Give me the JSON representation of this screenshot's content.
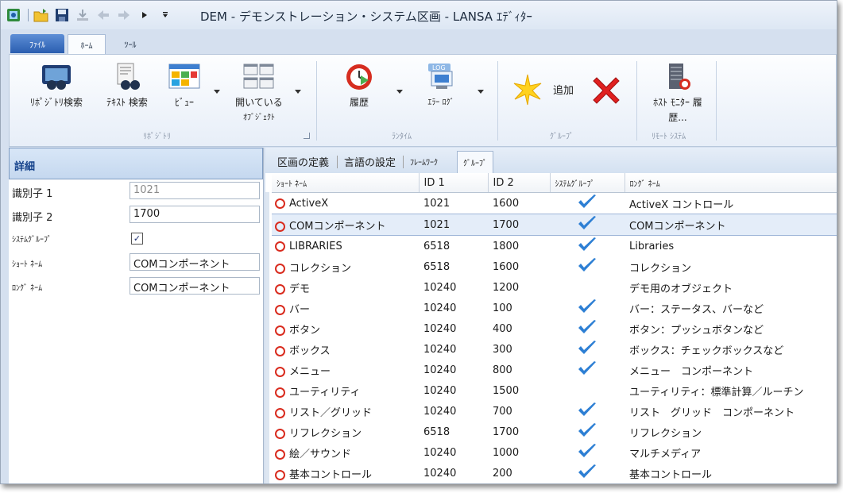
{
  "window": {
    "title": "DEM - デモンストレーション・システム区画 - LANSA ｴﾃﾞｨﾀｰ"
  },
  "quick_access": {
    "icons": [
      "app-icon",
      "open-folder-icon",
      "save-icon",
      "install-icon",
      "back-arrow-icon",
      "forward-arrow-icon",
      "play-icon",
      "customize-icon"
    ]
  },
  "ribbon_tabs": {
    "file": "ﾌｧｲﾙ",
    "home": "ﾎｰﾑ",
    "tools": "ﾂｰﾙ"
  },
  "ribbon": {
    "repo_search": "ﾘﾎﾟｼﾞﾄﾘ検索",
    "text_search": "ﾃｷｽﾄ 検索",
    "view": "ﾋﾞｭｰ",
    "open_objects_1": "開いている",
    "open_objects_2": "ｵﾌﾞｼﾞｪｸﾄ",
    "history": "履歴",
    "error_log": "ｴﾗｰ ﾛｸﾞ",
    "add": "追加",
    "host_monitor_1": "ﾎｽﾄ ﾓﾆﾀｰ 履",
    "host_monitor_2": "歴...",
    "group_repo": "ﾘﾎﾟｼﾞﾄﾘ",
    "group_runtime": "ﾗﾝﾀｲﾑ",
    "group_group": "ｸﾞﾙｰﾌﾟ",
    "group_remote": "ﾘﾓｰﾄ ｼｽﾃﾑ"
  },
  "details": {
    "header": "詳細",
    "id1_label": "識別子 1",
    "id1_value": "1021",
    "id2_label": "識別子 2",
    "id2_value": "1700",
    "sysgroup_label": "ｼｽﾃﾑｸﾞﾙｰﾌﾟ",
    "sysgroup_checked": "✓",
    "short_label": "ｼｮｰﾄ ﾈｰﾑ",
    "short_value": "COMコンポーネント",
    "long_label": "ﾛﾝｸﾞ ﾈｰﾑ",
    "long_value": "COMコンポーネント"
  },
  "doc_tabs": [
    "区画の定義",
    "言語の設定",
    "ﾌﾚｰﾑﾜｰｸ",
    "ｸﾞﾙｰﾌﾟ"
  ],
  "grid": {
    "headers": [
      "ｼｮｰﾄ ﾈｰﾑ",
      "ID 1",
      "ID 2",
      "ｼｽﾃﾑｸﾞﾙｰﾌﾟ",
      "ﾛﾝｸﾞ ﾈｰﾑ"
    ],
    "rows": [
      [
        "ActiveX",
        "1021",
        "1600",
        true,
        "ActiveX コントロール"
      ],
      [
        "COMコンポーネント",
        "1021",
        "1700",
        true,
        "COMコンポーネント"
      ],
      [
        "LIBRARIES",
        "6518",
        "1800",
        true,
        "Libraries"
      ],
      [
        "コレクション",
        "6518",
        "1600",
        true,
        "コレクション"
      ],
      [
        "デモ",
        "10240",
        "1200",
        false,
        "デモ用のオブジェクト"
      ],
      [
        "バー",
        "10240",
        "100",
        true,
        "バー：ステータス、バーなど"
      ],
      [
        "ボタン",
        "10240",
        "400",
        true,
        "ボタン：プッシュボタンなど"
      ],
      [
        "ボックス",
        "10240",
        "300",
        true,
        "ボックス：チェックボックスなど"
      ],
      [
        "メニュー",
        "10240",
        "800",
        true,
        "メニュー　コンポーネント"
      ],
      [
        "ユーティリティ",
        "10240",
        "1500",
        false,
        "ユーティリティ：標準計算／ルーチン"
      ],
      [
        "リスト／グリッド",
        "10240",
        "700",
        true,
        "リスト　グリッド　コンポーネント"
      ],
      [
        "リフレクション",
        "6518",
        "1700",
        true,
        "リフレクション"
      ],
      [
        "絵／サウンド",
        "10240",
        "1000",
        true,
        "マルチメディア"
      ],
      [
        "基本コントロール",
        "10240",
        "200",
        true,
        "基本コントロール"
      ]
    ],
    "selected_row": 1
  },
  "colors": {
    "accent": "#2a5eb0",
    "ring": "#d92b1e",
    "check": "#2d7fd4",
    "selection": "#e4edf9"
  }
}
